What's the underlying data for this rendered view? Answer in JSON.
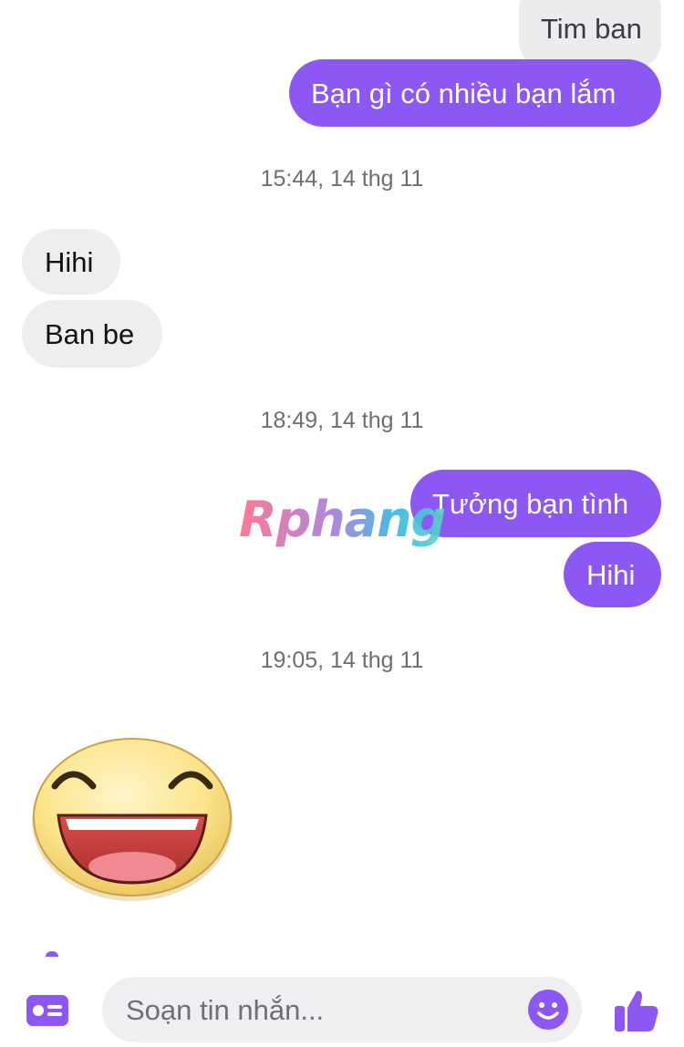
{
  "messages": {
    "quoted_reply": "Tim ban",
    "m1": "Bạn gì có nhiều bạn lắm",
    "ts1": "15:44, 14 thg 11",
    "m2": "Hihi",
    "m3": "Ban be",
    "ts2": "18:49, 14 thg 11",
    "m4": "Tưởng bạn tình",
    "m5": "Hihi",
    "ts3": "19:05, 14 thg 11"
  },
  "watermark": "Rphang",
  "composer": {
    "placeholder": "Soạn tin nhắn..."
  },
  "icons": {
    "left": "contact-card-icon",
    "emoji": "smiley-icon",
    "send": "thumbs-up-icon"
  },
  "colors": {
    "outgoing": "#8d57f4",
    "incoming": "#eeeef0",
    "accent": "#8d57f4"
  }
}
